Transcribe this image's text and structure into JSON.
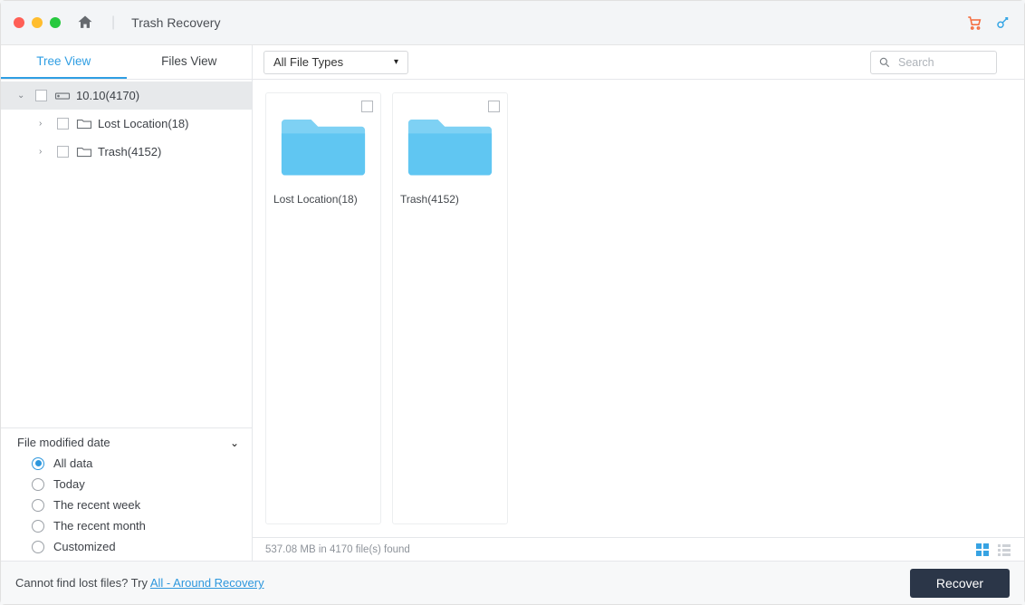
{
  "window": {
    "title": "Trash Recovery"
  },
  "tabs": {
    "tree": "Tree View",
    "files": "Files View"
  },
  "filetype": {
    "selected": "All File Types"
  },
  "search": {
    "placeholder": "Search"
  },
  "tree": {
    "root": {
      "label": "10.10(4170)"
    },
    "children": [
      {
        "label": "Lost Location(18)"
      },
      {
        "label": "Trash(4152)"
      }
    ]
  },
  "filter": {
    "title": "File modified date",
    "options": [
      "All data",
      "Today",
      "The recent week",
      "The recent month",
      "Customized"
    ],
    "selected": 0
  },
  "grid": {
    "items": [
      {
        "label": "Lost Location(18)"
      },
      {
        "label": "Trash(4152)"
      }
    ]
  },
  "status": {
    "text": "537.08 MB in 4170 file(s) found"
  },
  "footer": {
    "prompt": "Cannot find lost files? Try ",
    "link": "All - Around Recovery",
    "button": "Recover"
  }
}
